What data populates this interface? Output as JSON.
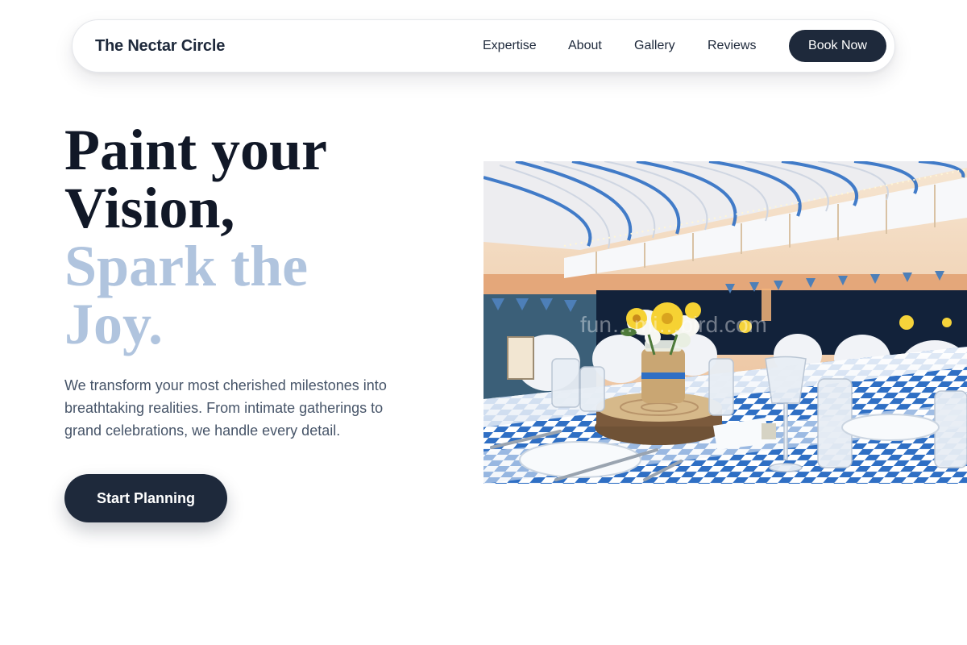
{
  "nav": {
    "brand": "The Nectar Circle",
    "links": [
      "Expertise",
      "About",
      "Gallery",
      "Reviews"
    ],
    "cta_label": "Book Now"
  },
  "hero": {
    "title_dark_line1": "Paint your",
    "title_dark_line2": "Vision,",
    "title_light_line1": "Spark the",
    "title_light_line2": "Joy.",
    "subtitle": "We transform your most cherished milestones into breathtaking realities. From intimate gatherings to grand celebrations, we handle every detail.",
    "cta_label": "Start Planning",
    "image": {
      "subject": "banquet-hall-table-setting",
      "watermark": "fun…mi…bird.com"
    }
  },
  "colors": {
    "primary": "#1e293b",
    "accent_light": "#b0c4de",
    "text_muted": "#475569",
    "heading": "#111827"
  }
}
